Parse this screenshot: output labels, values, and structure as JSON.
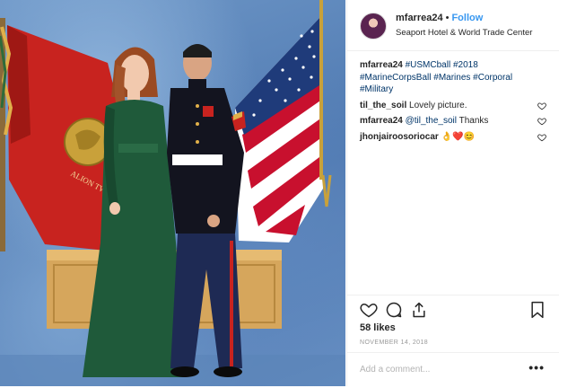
{
  "post": {
    "username": "mfarrea24",
    "separator": "•",
    "follow_label": "Follow",
    "location": "Seaport Hotel & World Trade Center",
    "caption": {
      "username": "mfarrea24",
      "hashtags": "#USMCball #2018 #MarineCorpsBall #Marines #Corporal #Military"
    },
    "comments": [
      {
        "username": "til_the_soil",
        "text": "Lovely picture."
      },
      {
        "username": "mfarrea24",
        "mention": "@til_the_soil",
        "text": "Thanks"
      },
      {
        "username": "jhonjairoosoriocar",
        "text": "👌❤️😊"
      }
    ],
    "likes": "58 likes",
    "date": "NOVEMBER 14, 2018",
    "add_comment_placeholder": "Add a comment...",
    "more_label": "•••"
  },
  "photo": {
    "flag_text": "ALION TWE"
  },
  "icons": {
    "avatar": "profile-avatar",
    "like": "heart-icon",
    "comment": "comment-icon",
    "share": "share-icon",
    "save": "bookmark-icon",
    "comment_like": "small-heart-icon",
    "more": "more-options-icon"
  },
  "colors": {
    "link_blue": "#3897f0",
    "hashtag_blue": "#003569",
    "border": "#efefef",
    "meta_gray": "#999999"
  }
}
